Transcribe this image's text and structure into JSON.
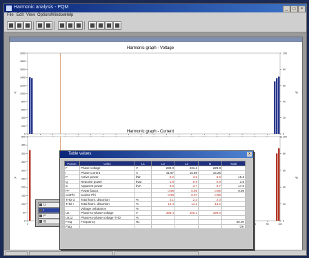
{
  "window": {
    "title": "Harmonic analysis - PQM"
  },
  "menu": [
    "File",
    "Edit",
    "View",
    "Options",
    "Window",
    "Help"
  ],
  "toolbar_icons": [
    "open-icon",
    "save-icon",
    "print-icon",
    "copy-icon",
    "zoom-icon",
    "graph-icon",
    "table-icon",
    "settings-icon",
    "help-icon"
  ],
  "charts": [
    {
      "title": "Harmonic graph - Voltage",
      "ylabel": "V",
      "y2label": "%",
      "y_ticks": [
        "0",
        "200",
        "400",
        "600",
        "800",
        "1000",
        "1200",
        "1400",
        "1600",
        "1800",
        "2000"
      ],
      "y2_ticks": [
        "0",
        "20",
        "40",
        "60",
        "80",
        "100"
      ],
      "x_ticks": [
        "0",
        "5",
        "10",
        "15",
        "20",
        "25",
        "30",
        "35",
        "40",
        "45",
        "50",
        "55",
        "60",
        "65",
        "70",
        "75",
        "80",
        "85",
        "90",
        "95",
        "100"
      ],
      "bars_left": [
        1400,
        1380
      ],
      "bars_right": [
        1300,
        1380,
        1420
      ],
      "bar_color": "#2a3a8e"
    },
    {
      "title": "Harmonic graph - Current",
      "ylabel": "A",
      "y2label": "%",
      "y_ticks": [
        "0",
        "50",
        "100",
        "150",
        "200",
        "250",
        "300",
        "350",
        "400",
        "450",
        "500"
      ],
      "y2_ticks": [
        "0",
        "20",
        "40",
        "60",
        "80",
        "100"
      ],
      "x_ticks": [
        "0",
        "5",
        "10",
        "15",
        "20",
        "25",
        "30",
        "35",
        "40",
        "45",
        "50",
        "55",
        "60",
        "65",
        "70",
        "75",
        "80",
        "85",
        "90",
        "95",
        "100"
      ],
      "bars_left": [
        420
      ],
      "bars_right": [
        400,
        430
      ],
      "bar_color": "#b33a2a"
    }
  ],
  "dialog": {
    "title": "Table values",
    "close": "x",
    "headers": [
      "Param.",
      "Units",
      "L1",
      "L2",
      "L3",
      "N",
      "Total"
    ],
    "rows": [
      [
        "F",
        "Phase voltage",
        "V",
        "230.0",
        "231.2",
        "229.8",
        ""
      ],
      [
        "I",
        "Phase current",
        "A",
        "41.67",
        "15.89",
        "16.26",
        ""
      ],
      [
        "P",
        "Active power",
        "kW",
        "9.2",
        "3.5",
        "3.6",
        "16.3"
      ],
      [
        "Q",
        "Reactive power",
        "kvar",
        "1.8",
        "0.9",
        "0.9",
        "3.6"
      ],
      [
        "S",
        "Apparent power",
        "kVA",
        "9.6",
        "3.7",
        "3.7",
        "17.0"
      ],
      [
        "PF",
        "Power factor",
        "",
        "0.96",
        "0.95",
        "0.96",
        "0.96"
      ],
      [
        "cosPhi",
        "Cosine Phi",
        "",
        "0.98",
        "0.97",
        "0.98",
        ""
      ],
      [
        "THD U",
        "Total harm. distortion",
        "%",
        "2.1",
        "2.3",
        "2.0",
        ""
      ],
      [
        "THD I",
        "Total harm. distortion",
        "%",
        "12.4",
        "14.1",
        "13.2",
        ""
      ],
      [
        "",
        "Voltage unbalance",
        "%",
        "",
        "",
        "",
        ""
      ],
      [
        "Ux",
        "Phase-to-phase voltage",
        "V",
        "398.4",
        "400.1",
        "399.0",
        ""
      ],
      [
        "Ux12",
        "Phase-to-phase voltage THD",
        "%",
        "",
        "",
        "",
        ""
      ],
      [
        "Freq",
        "Frequency",
        "Hz",
        "",
        "",
        "",
        "50.00"
      ],
      [
        "Flag",
        "",
        "",
        "",
        "",
        "",
        "OK"
      ]
    ],
    "red_cols": [
      3,
      4,
      5
    ]
  },
  "minilist": {
    "items": [
      "U",
      "I",
      "P",
      "Q"
    ],
    "selected": 1
  },
  "status": {
    "left": "Ready"
  }
}
